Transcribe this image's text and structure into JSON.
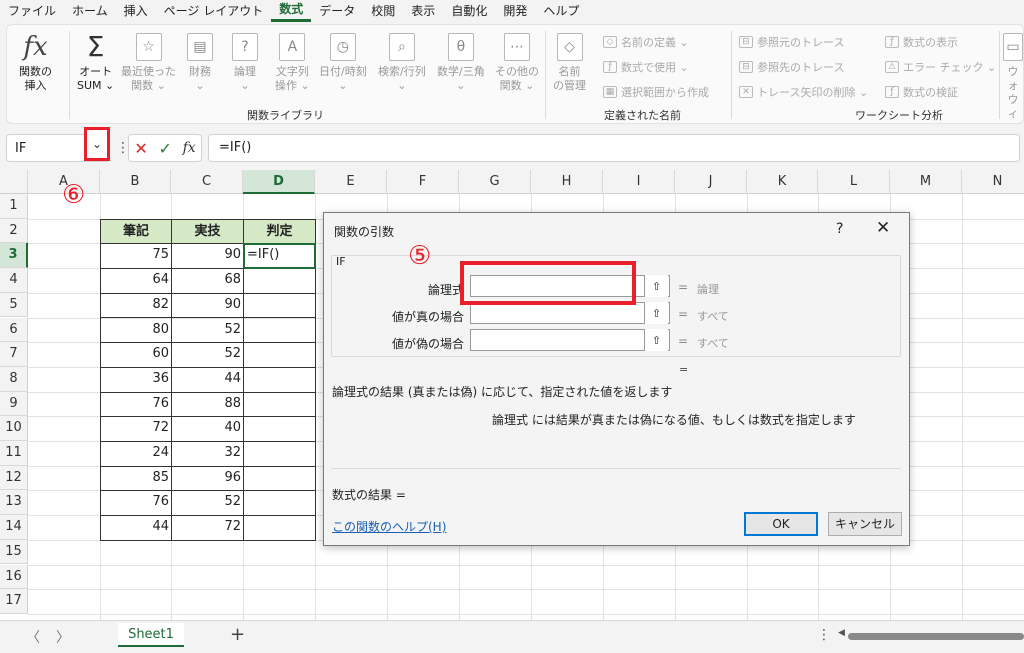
{
  "menu": [
    "ファイル",
    "ホーム",
    "挿入",
    "ページ レイアウト",
    "数式",
    "データ",
    "校閲",
    "表示",
    "自動化",
    "開発",
    "ヘルプ"
  ],
  "menu_active_index": 4,
  "ribbon": {
    "insert_function": [
      "関数の",
      "挿入"
    ],
    "autosum": [
      "オート",
      "SUM ⌄"
    ],
    "recent": [
      "最近使った",
      "関数 ⌄"
    ],
    "financial": [
      "財務",
      "⌄"
    ],
    "logical": [
      "論理",
      "⌄"
    ],
    "text": [
      "文字列",
      "操作 ⌄"
    ],
    "datetime": [
      "日付/時刻",
      "⌄"
    ],
    "lookup": [
      "検索/行列",
      "⌄"
    ],
    "math": [
      "数学/三角",
      "⌄"
    ],
    "other": [
      "その他の",
      "関数 ⌄"
    ],
    "group_library": "関数ライブラリ",
    "name_manager": [
      "名前",
      "の管理"
    ],
    "define_name": "名前の定義 ⌄",
    "use_in_formula": "数式で使用 ⌄",
    "create_from_selection": "選択範囲から作成",
    "group_names": "定義された名前",
    "trace_precedents": "参照元のトレース",
    "trace_dependents": "参照先のトレース",
    "remove_arrows": "トレース矢印の削除 ⌄",
    "show_formulas": "数式の表示",
    "error_check": "エラー チェック ⌄",
    "evaluate": "数式の検証",
    "group_audit": "ワークシート分析",
    "watch_window": [
      "ウォ",
      "ウィ"
    ]
  },
  "formula_bar": {
    "name_box": "IF",
    "formula": "=IF()"
  },
  "columns": [
    "A",
    "B",
    "C",
    "D",
    "E",
    "F",
    "G",
    "H",
    "I",
    "J",
    "K",
    "L",
    "M",
    "N"
  ],
  "rows": [
    "1",
    "2",
    "3",
    "4",
    "5",
    "6",
    "7",
    "8",
    "9",
    "10",
    "11",
    "12",
    "13",
    "14",
    "15",
    "16",
    "17"
  ],
  "table": {
    "headers": [
      "筆記",
      "実技",
      "判定"
    ],
    "rows": [
      [
        "75",
        "90",
        "=IF()"
      ],
      [
        "64",
        "68",
        ""
      ],
      [
        "82",
        "90",
        ""
      ],
      [
        "80",
        "52",
        ""
      ],
      [
        "60",
        "52",
        ""
      ],
      [
        "36",
        "44",
        ""
      ],
      [
        "76",
        "88",
        ""
      ],
      [
        "72",
        "40",
        ""
      ],
      [
        "24",
        "32",
        ""
      ],
      [
        "85",
        "96",
        ""
      ],
      [
        "76",
        "52",
        ""
      ],
      [
        "44",
        "72",
        ""
      ]
    ]
  },
  "annotations": {
    "five": "⑤",
    "six": "⑥"
  },
  "dialog": {
    "title": "関数の引数",
    "help": "?",
    "close": "✕",
    "function_name": "IF",
    "args": [
      {
        "label": "論理式",
        "type": "論理"
      },
      {
        "label": "値が真の場合",
        "type": "すべて"
      },
      {
        "label": "値が偽の場合",
        "type": "すべて"
      }
    ],
    "eq": "=",
    "description": "論理式の結果 (真または偽) に応じて、指定された値を返します",
    "arg_description": "論理式  には結果が真または偽になる値、もしくは数式を指定します",
    "result_label": "数式の結果 =",
    "help_link": "この関数のヘルプ(H)",
    "ok": "OK",
    "cancel": "キャンセル"
  },
  "sheet_tabs": {
    "nav_prev": "〈",
    "nav_next": "〉",
    "sheet": "Sheet1",
    "add": "+",
    "dots": "⋮",
    "scroll_left": "◀"
  }
}
